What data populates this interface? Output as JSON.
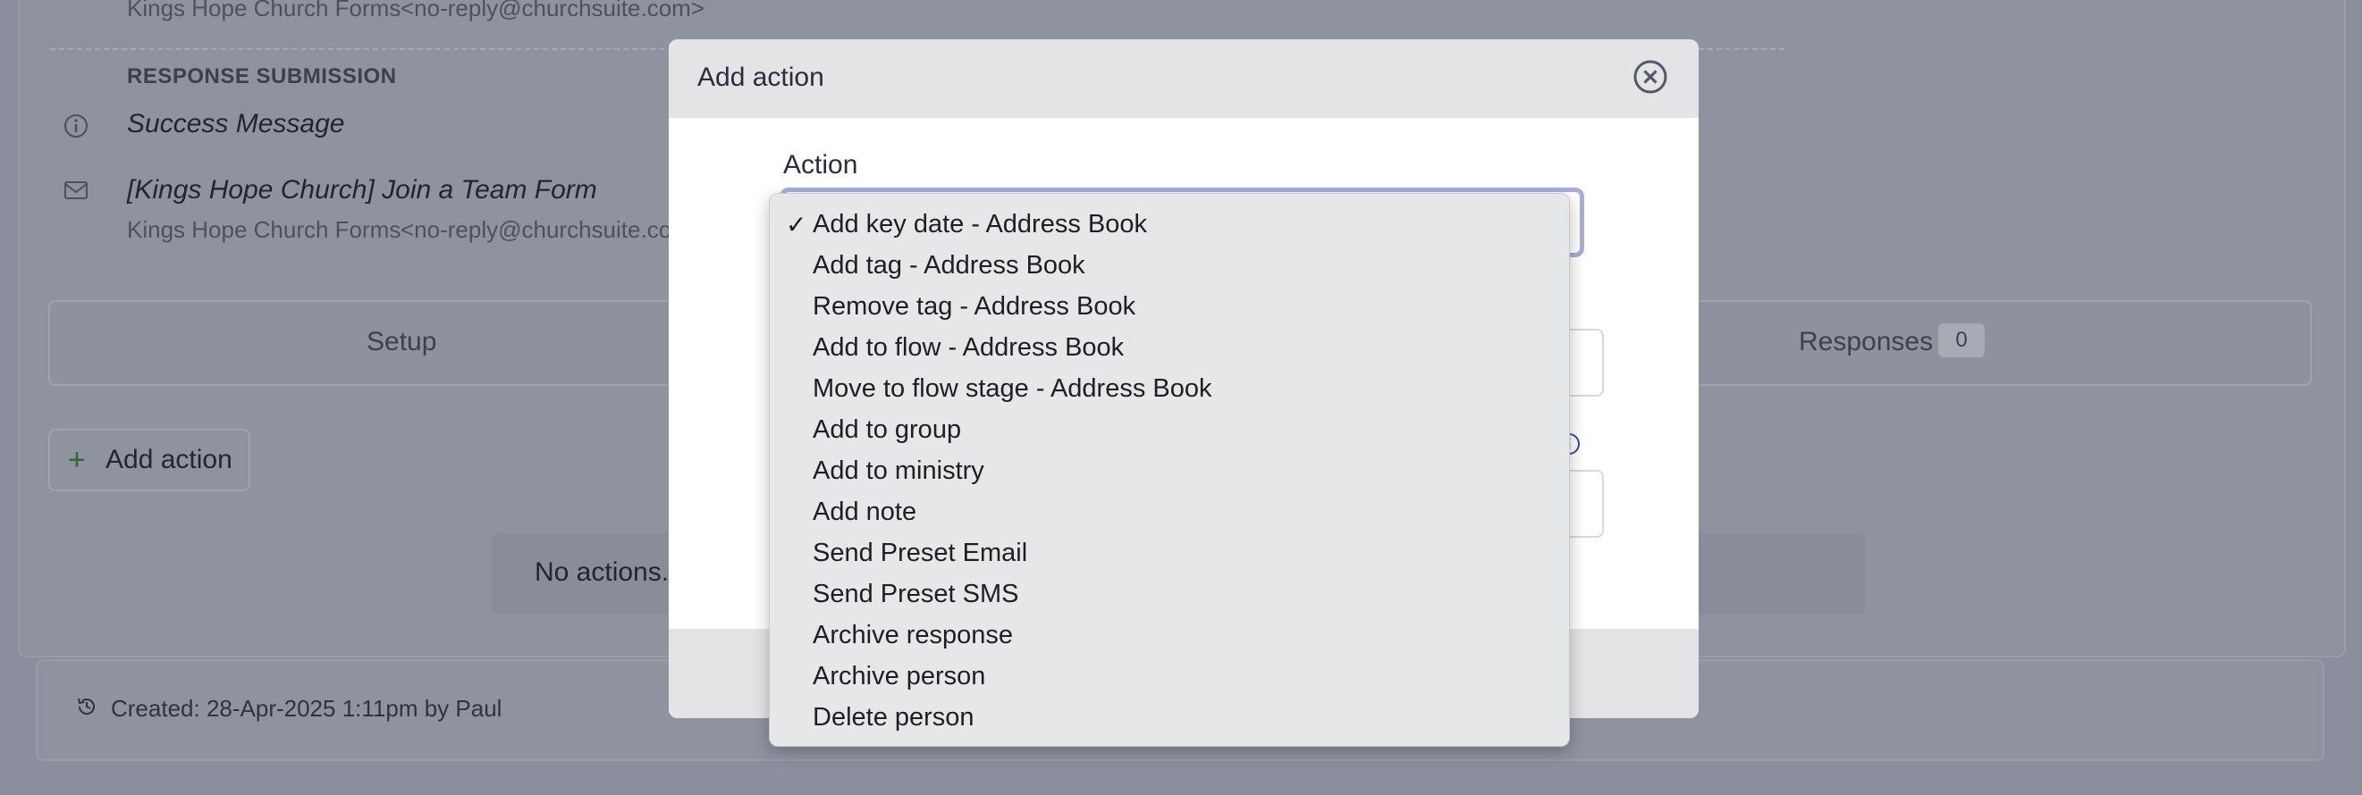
{
  "background": {
    "top_sender": {
      "name": "Kings Hope Church Forms",
      "email": "<no-reply@churchsuite.com>"
    },
    "section_label": "RESPONSE SUBMISSION",
    "items": [
      {
        "title": "Success Message",
        "icon": "info-icon"
      },
      {
        "title": "[Kings Hope Church] Join a Team Form",
        "icon": "mail-icon",
        "sender_name": "Kings Hope Church Forms",
        "sender_email": "<no-reply@churchsuite.com>"
      }
    ],
    "tabs": [
      {
        "label": "Setup"
      },
      {
        "label": "Responses",
        "count": "0"
      }
    ],
    "add_action_label": "Add action",
    "empty_message": "No actions.",
    "created": "Created: 28-Apr-2025 1:11pm by Paul"
  },
  "modal": {
    "title": "Add action",
    "field_label": "Action",
    "options": [
      {
        "label": "Add key date - Address Book",
        "selected": true
      },
      {
        "label": "Add tag - Address Book",
        "selected": false
      },
      {
        "label": "Remove tag - Address Book",
        "selected": false
      },
      {
        "label": "Add to flow - Address Book",
        "selected": false
      },
      {
        "label": "Move to flow stage - Address Book",
        "selected": false
      },
      {
        "label": "Add to group",
        "selected": false
      },
      {
        "label": "Add to ministry",
        "selected": false
      },
      {
        "label": "Add note",
        "selected": false
      },
      {
        "label": "Send Preset Email",
        "selected": false
      },
      {
        "label": "Send Preset SMS",
        "selected": false
      },
      {
        "label": "Archive response",
        "selected": false
      },
      {
        "label": "Archive person",
        "selected": false
      },
      {
        "label": "Delete person",
        "selected": false
      }
    ],
    "check_mark": "✓"
  },
  "colors": {
    "overlay_bg": "#8b8e9c",
    "modal_header": "#e4e4e6",
    "dropdown_bg": "#e6e7e9",
    "focus_ring": "#a9aed8"
  }
}
